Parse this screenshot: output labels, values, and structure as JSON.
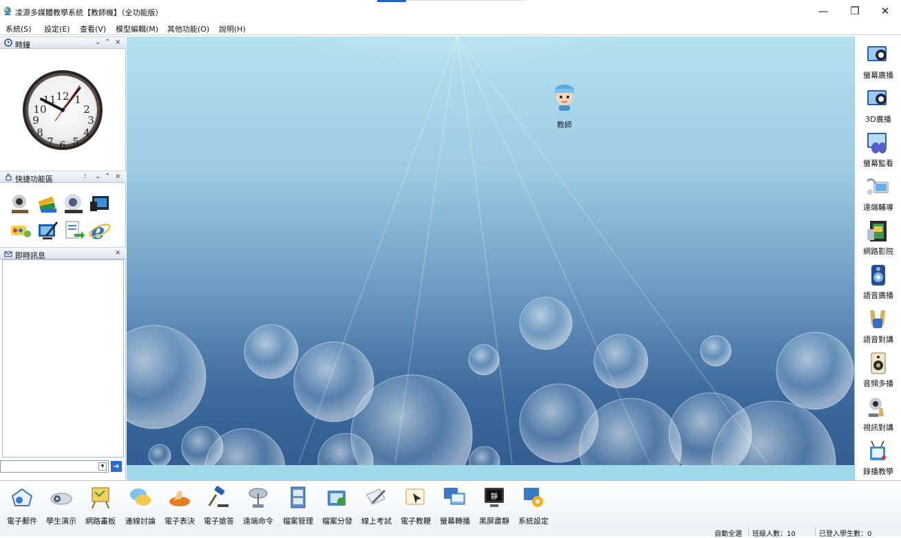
{
  "window": {
    "title": "凌源多媒體教學系統【教師機】（全功能版）",
    "controls": {
      "minimize": "—",
      "restore": "❐",
      "close": "✕"
    }
  },
  "menu": [
    "系統(S)",
    "設定(E)",
    "查看(V)",
    "模型編輯(M)",
    "其他功能(O)",
    "說明(H)"
  ],
  "panels": {
    "clock": {
      "title": "時鐘",
      "controls": [
        "⌄",
        "⌃",
        "×"
      ],
      "numerals": [
        "12",
        "1",
        "2",
        "3",
        "4",
        "5",
        "6",
        "7",
        "8",
        "9",
        "10",
        "11"
      ]
    },
    "quick": {
      "title": "快捷功能區",
      "controls": [
        "⁝",
        "⌄",
        "⌃",
        "×"
      ],
      "icons": [
        "webcam-icon",
        "books-icon",
        "film-projector-icon",
        "monitor-bag-icon",
        "color-palette-icon",
        "edit-screen-icon",
        "document-arrow-icon",
        "internet-explorer-icon"
      ]
    },
    "messages": {
      "title": "即時訊息",
      "close": "×",
      "send": "➔"
    }
  },
  "desktop": {
    "teacher_label": "教師"
  },
  "right_toolbar": [
    {
      "label": "螢幕廣播",
      "icon": "screen-broadcast-icon"
    },
    {
      "label": "3D廣播",
      "icon": "3d-broadcast-icon"
    },
    {
      "label": "螢幕監看",
      "icon": "binoculars-monitor-icon"
    },
    {
      "label": "遠端輔導",
      "icon": "remote-assist-icon"
    },
    {
      "label": "網路影院",
      "icon": "film-strip-icon"
    },
    {
      "label": "語音廣播",
      "icon": "speaker-icon"
    },
    {
      "label": "語音對講",
      "icon": "handset-icon"
    },
    {
      "label": "音頻多播",
      "icon": "audio-box-icon"
    },
    {
      "label": "視訊對講",
      "icon": "video-talk-icon"
    },
    {
      "label": "錄播教學",
      "icon": "recording-tv-icon"
    }
  ],
  "bottom_toolbar": [
    {
      "label": "電子郵件",
      "icon": "email-icon"
    },
    {
      "label": "學生演示",
      "icon": "projector-icon"
    },
    {
      "label": "網路畫板",
      "icon": "easel-icon"
    },
    {
      "label": "連線討論",
      "icon": "chat-bubbles-icon"
    },
    {
      "label": "電子表決",
      "icon": "vote-hand-icon"
    },
    {
      "label": "電子搶答",
      "icon": "gavel-icon"
    },
    {
      "label": "遠端命令",
      "icon": "satellite-dish-icon"
    },
    {
      "label": "檔案管理",
      "icon": "file-cabinet-icon"
    },
    {
      "label": "檔案分發",
      "icon": "folder-send-icon"
    },
    {
      "label": "線上考試",
      "icon": "exam-pen-icon"
    },
    {
      "label": "電子教鞭",
      "icon": "pointer-icon"
    },
    {
      "label": "螢幕轉播",
      "icon": "screen-relay-icon"
    },
    {
      "label": "黑屏肅靜",
      "icon": "black-screen-icon"
    },
    {
      "label": "系統設定",
      "icon": "settings-gear-icon"
    }
  ],
  "status": {
    "select_all": "自動全選",
    "class_count": "班級人數：10",
    "logged_in": "已登入學生數：0"
  },
  "colors": {
    "accent": "#1e63b8",
    "desktop_top": "#b4e1ef",
    "desktop_bottom": "#2f5a8e",
    "send_button": "#2f6bc7"
  }
}
